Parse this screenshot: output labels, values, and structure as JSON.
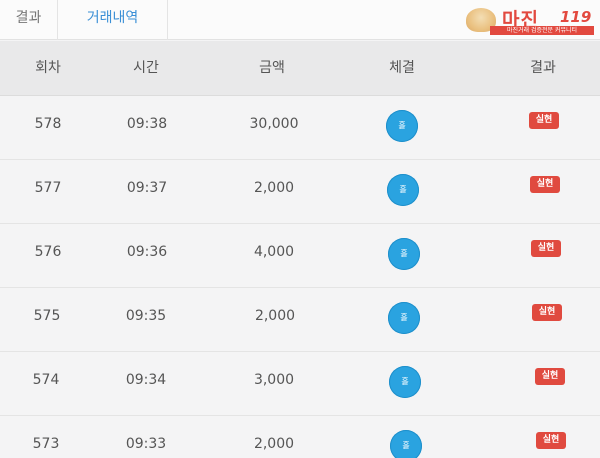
{
  "tabs": [
    {
      "label": "결과",
      "active": false
    },
    {
      "label": "거래내역",
      "active": true
    }
  ],
  "logo": {
    "name": "마진",
    "number": "119",
    "subtitle": "마진거래 검증전문 커뮤니티"
  },
  "table": {
    "columns": [
      "회차",
      "시간",
      "금액",
      "체결",
      "결과"
    ],
    "rows": [
      {
        "round": "578",
        "time": "09:38",
        "amount": "30,000",
        "execution": "홀",
        "result": "실현"
      },
      {
        "round": "577",
        "time": "09:37",
        "amount": "2,000",
        "execution": "홀",
        "result": "실현"
      },
      {
        "round": "576",
        "time": "09:36",
        "amount": "4,000",
        "execution": "홀",
        "result": "실현"
      },
      {
        "round": "575",
        "time": "09:35",
        "amount": "2,000",
        "execution": "홀",
        "result": "실현"
      },
      {
        "round": "574",
        "time": "09:34",
        "amount": "3,000",
        "execution": "홀",
        "result": "실현"
      },
      {
        "round": "573",
        "time": "09:33",
        "amount": "2,000",
        "execution": "홀",
        "result": "실현"
      }
    ]
  },
  "colors": {
    "accent": "#3a8fd6",
    "execution_button": "#2aa3e0",
    "result_badge": "#e04a3f",
    "header_bg": "#e9e9ea"
  }
}
